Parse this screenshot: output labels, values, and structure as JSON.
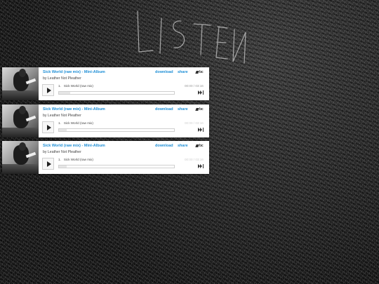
{
  "background": {
    "scrawl_text": "LISTEN"
  },
  "players": [
    {
      "title": "Sick World (raw mix) - Mini-Album",
      "artist": "by Leather Not Pleather",
      "download_label": "download",
      "share_label": "share",
      "logo_text": "bc",
      "track_number": "1.",
      "track_name": "Sick World (raw mix)",
      "time": "00:00 / 03:16",
      "progress_fraction": 0.1,
      "time_faded": false
    },
    {
      "title": "Sick World (raw mix) - Mini-Album",
      "artist": "by Leather Not Pleather",
      "download_label": "download",
      "share_label": "share",
      "logo_text": "bc",
      "track_number": "1.",
      "track_name": "Sick World (raw mix)",
      "time": "00:00 / 03:16",
      "progress_fraction": 0.07,
      "time_faded": true
    },
    {
      "title": "Sick World (raw mix) - Mini-Album",
      "artist": "by Leather Not Pleather",
      "download_label": "download",
      "share_label": "share",
      "logo_text": "bc",
      "track_number": "1.",
      "track_name": "Sick World (raw mix)",
      "time": "00:00 / 03:16",
      "progress_fraction": 0.07,
      "time_faded": true
    }
  ],
  "colors": {
    "link": "#1f8fd6",
    "text": "#444444"
  }
}
